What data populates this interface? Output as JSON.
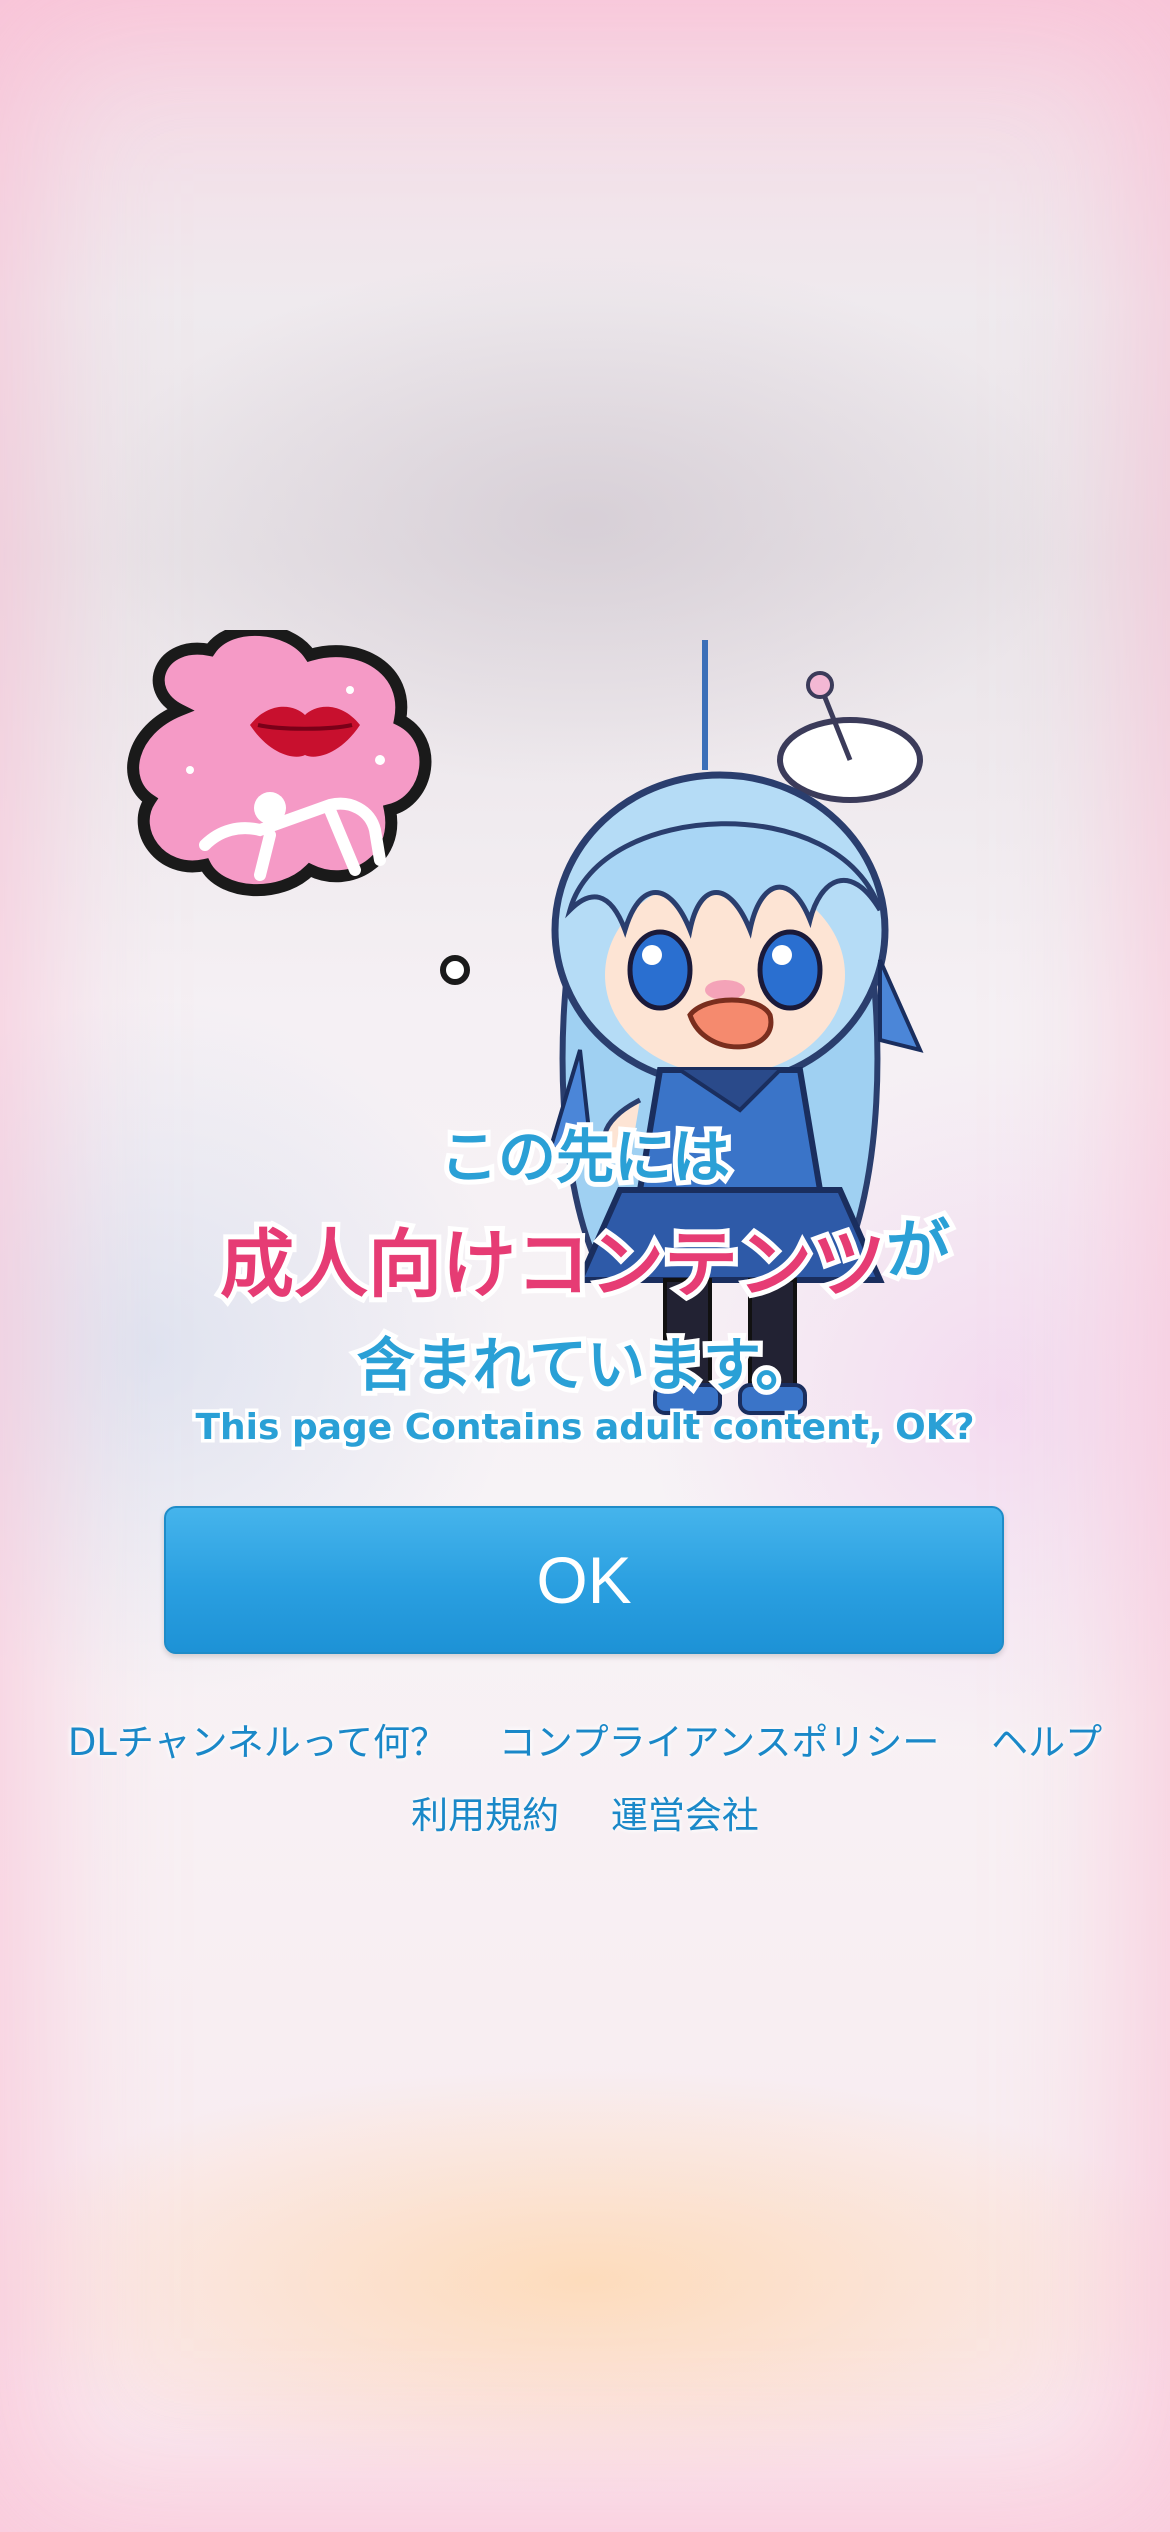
{
  "warning": {
    "line1": "この先には",
    "line2_main": "成人向けコンテンツ",
    "line2_suffix": "が",
    "line3": "含まれています。",
    "line4": "This page Contains adult content, OK?"
  },
  "ok_button": {
    "label": "OK"
  },
  "footer_links": {
    "row1": [
      "DLチャンネルって何？",
      "コンプライアンスポリシー",
      "ヘルプ"
    ],
    "row2": [
      "利用規約",
      "運営会社"
    ]
  },
  "colors": {
    "accent_blue": "#2aa0d6",
    "accent_pink": "#e63c74",
    "button_blue": "#2a9fe0",
    "link_blue": "#1a88c8"
  },
  "icons": {
    "mascot": "chibi-girl-surprised-illustration",
    "thought_bubble": "pink-thought-bubble-icon",
    "lips": "red-lips-icon"
  }
}
